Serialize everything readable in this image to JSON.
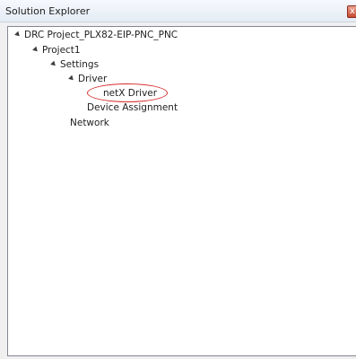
{
  "window": {
    "title": "Solution Explorer",
    "close_glyph": "x"
  },
  "tree": {
    "solution": {
      "label": "DRC Project_PLX82-EIP-PNC_PNC",
      "expanded": true
    },
    "project": {
      "label": "Project1",
      "expanded": true
    },
    "settings": {
      "label": "Settings",
      "expanded": true
    },
    "driver": {
      "label": "Driver",
      "expanded": true
    },
    "netx_driver": {
      "label": "netX Driver",
      "highlighted": true
    },
    "device_assignment": {
      "label": "Device Assignment"
    },
    "network": {
      "label": "Network"
    }
  },
  "colors": {
    "highlight_ring": "#d82a2a",
    "close_button": "#c74a31",
    "panel_border": "#828790"
  },
  "icons": {
    "expanded": "triangle-expanded-icon",
    "close": "close-icon"
  }
}
